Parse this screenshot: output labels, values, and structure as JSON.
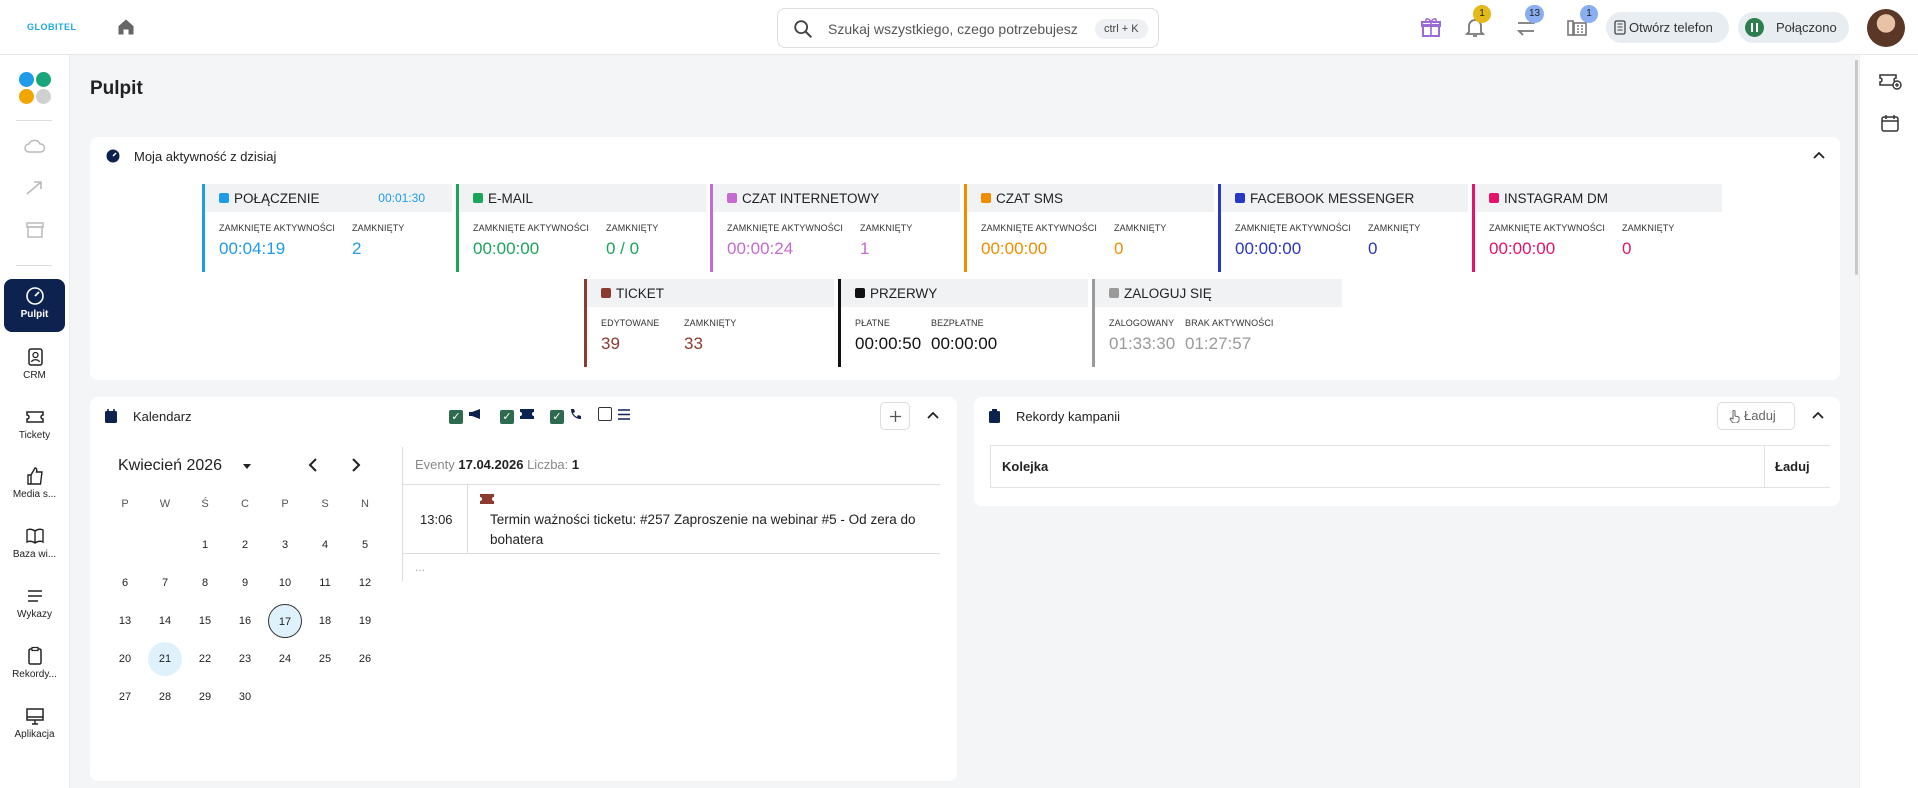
{
  "app": {
    "logo": "GLOBITEL"
  },
  "search": {
    "placeholder": "Szukaj wszystkiego, czego potrzebujesz",
    "shortcut": "ctrl + K"
  },
  "top": {
    "bell_badge": "1",
    "transfer_badge": "13",
    "phone_badge": "1",
    "open_phone": "Otwórz telefon",
    "connected": "Połączono"
  },
  "sidebar": {
    "items": [
      "Pulpit",
      "CRM",
      "Tickety",
      "Media s...",
      "Baza wi...",
      "Wykazy",
      "Rekordy...",
      "Aplikacja"
    ]
  },
  "page": {
    "title": "Pulpit"
  },
  "activity": {
    "title": "Moja aktywność z dzisiaj",
    "tiles": [
      {
        "name": "POŁĄCZENIE",
        "time": "00:01:30",
        "l1": "ZAMKNIĘTE AKTYWNOŚCI",
        "v1": "00:04:19",
        "l2": "ZAMKNIĘTY",
        "v2": "2",
        "color": "#1e9be9"
      },
      {
        "name": "E-MAIL",
        "l1": "ZAMKNIĘTE AKTYWNOŚCI",
        "v1": "00:00:00",
        "l2": "ZAMKNIĘTY",
        "v2": "0 / 0",
        "color": "#1aa55a"
      },
      {
        "name": "CZAT INTERNETOWY",
        "l1": "ZAMKNIĘTE AKTYWNOŚCI",
        "v1": "00:00:24",
        "l2": "ZAMKNIĘTY",
        "v2": "1",
        "color": "#c56ad2"
      },
      {
        "name": "CZAT SMS",
        "l1": "ZAMKNIĘTE AKTYWNOŚCI",
        "v1": "00:00:00",
        "l2": "ZAMKNIĘTY",
        "v2": "0",
        "color": "#f08c00"
      },
      {
        "name": "FACEBOOK MESSENGER",
        "l1": "ZAMKNIĘTE AKTYWNOŚCI",
        "v1": "00:00:00",
        "l2": "ZAMKNIĘTY",
        "v2": "0",
        "color": "#2b36c7"
      },
      {
        "name": "INSTAGRAM DM",
        "l1": "ZAMKNIĘTE AKTYWNOŚCI",
        "v1": "00:00:00",
        "l2": "ZAMKNIĘTY",
        "v2": "0",
        "color": "#e5136a"
      },
      {
        "name": "TICKET",
        "l1": "EDYTOWANE",
        "v1": "39",
        "l2": "ZAMKNIĘTY",
        "v2": "33",
        "color": "#8c3b2f"
      },
      {
        "name": "PRZERWY",
        "l1": "PŁATNE",
        "v1": "00:00:50",
        "l2": "BEZPŁATNE",
        "v2": "00:00:00",
        "color": "#111111"
      },
      {
        "name": "ZALOGUJ SIĘ",
        "l1": "ZALOGOWANY",
        "v1": "01:33:30",
        "l2": "BRAK AKTYWNOŚCI",
        "v2": "01:27:57",
        "color": "#9a9a9a"
      }
    ]
  },
  "calendar": {
    "title": "Kalendarz",
    "month": "Kwiecień 2026",
    "dow": [
      "P",
      "W",
      "Ś",
      "C",
      "P",
      "S",
      "N"
    ],
    "days": [
      "1",
      "2",
      "3",
      "4",
      "5",
      "6",
      "7",
      "8",
      "9",
      "10",
      "11",
      "12",
      "13",
      "14",
      "15",
      "16",
      "17",
      "18",
      "19",
      "20",
      "21",
      "22",
      "23",
      "24",
      "25",
      "26",
      "27",
      "28",
      "29",
      "30"
    ],
    "selected": "17",
    "today": "21",
    "events_label": "Eventy",
    "events_date": "17.04.2026",
    "count_label": "Liczba:",
    "count": "1",
    "event_time": "13:06",
    "event_text": "Termin ważności ticketu: #257 Zaproszenie na webinar #5 - Od zera do bohatera",
    "more": "..."
  },
  "campaign": {
    "title": "Rekordy kampanii",
    "load": "Ładuj",
    "col1": "Kolejka",
    "col2": "Ładuj"
  }
}
